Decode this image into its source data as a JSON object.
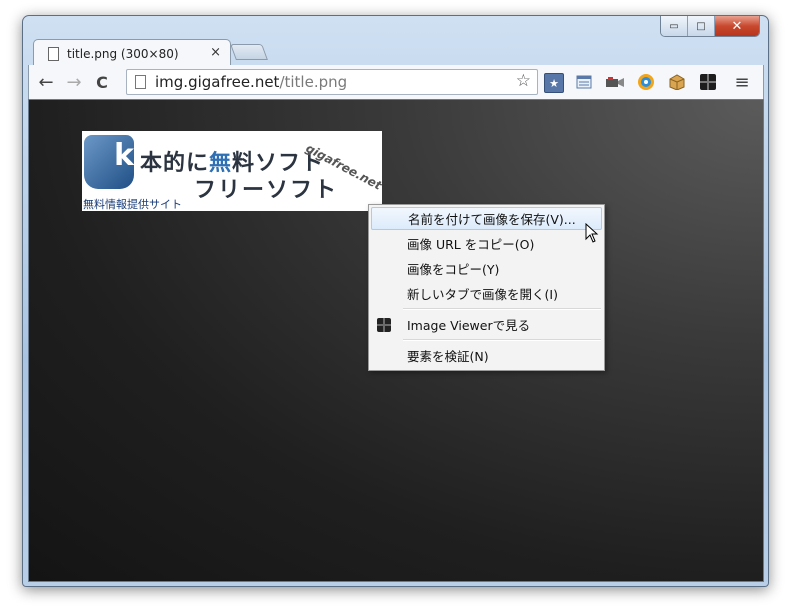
{
  "window": {
    "minimize_glyph": "▭",
    "maximize_glyph": "□",
    "close_glyph": "✕"
  },
  "tab": {
    "title": "title.png (300×80)",
    "close_glyph": "×"
  },
  "toolbar": {
    "back_glyph": "←",
    "forward_glyph": "→",
    "reload_glyph": "C",
    "url_host": "img.gigafree.net",
    "url_path": "/title.png",
    "star_glyph": "☆",
    "menu_glyph": "≡",
    "extensions": [
      "bookmark-star-icon",
      "reader-icon",
      "camera-icon",
      "gear-icon",
      "box-icon",
      "image-viewer-icon"
    ]
  },
  "banner": {
    "line1_a": "本的に",
    "line1_hl": "無",
    "line1_b": "料ソフト",
    "line2": "フリーソフト",
    "brand": "gigafree.net",
    "tagline": "無料情報提供サイト"
  },
  "context_menu": {
    "save_image": "名前を付けて画像を保存(V)...",
    "copy_url": "画像 URL をコピー(O)",
    "copy_image": "画像をコピー(Y)",
    "open_new_tab": "新しいタブで画像を開く(I)",
    "image_viewer": "Image Viewerで見る",
    "inspect": "要素を検証(N)"
  }
}
